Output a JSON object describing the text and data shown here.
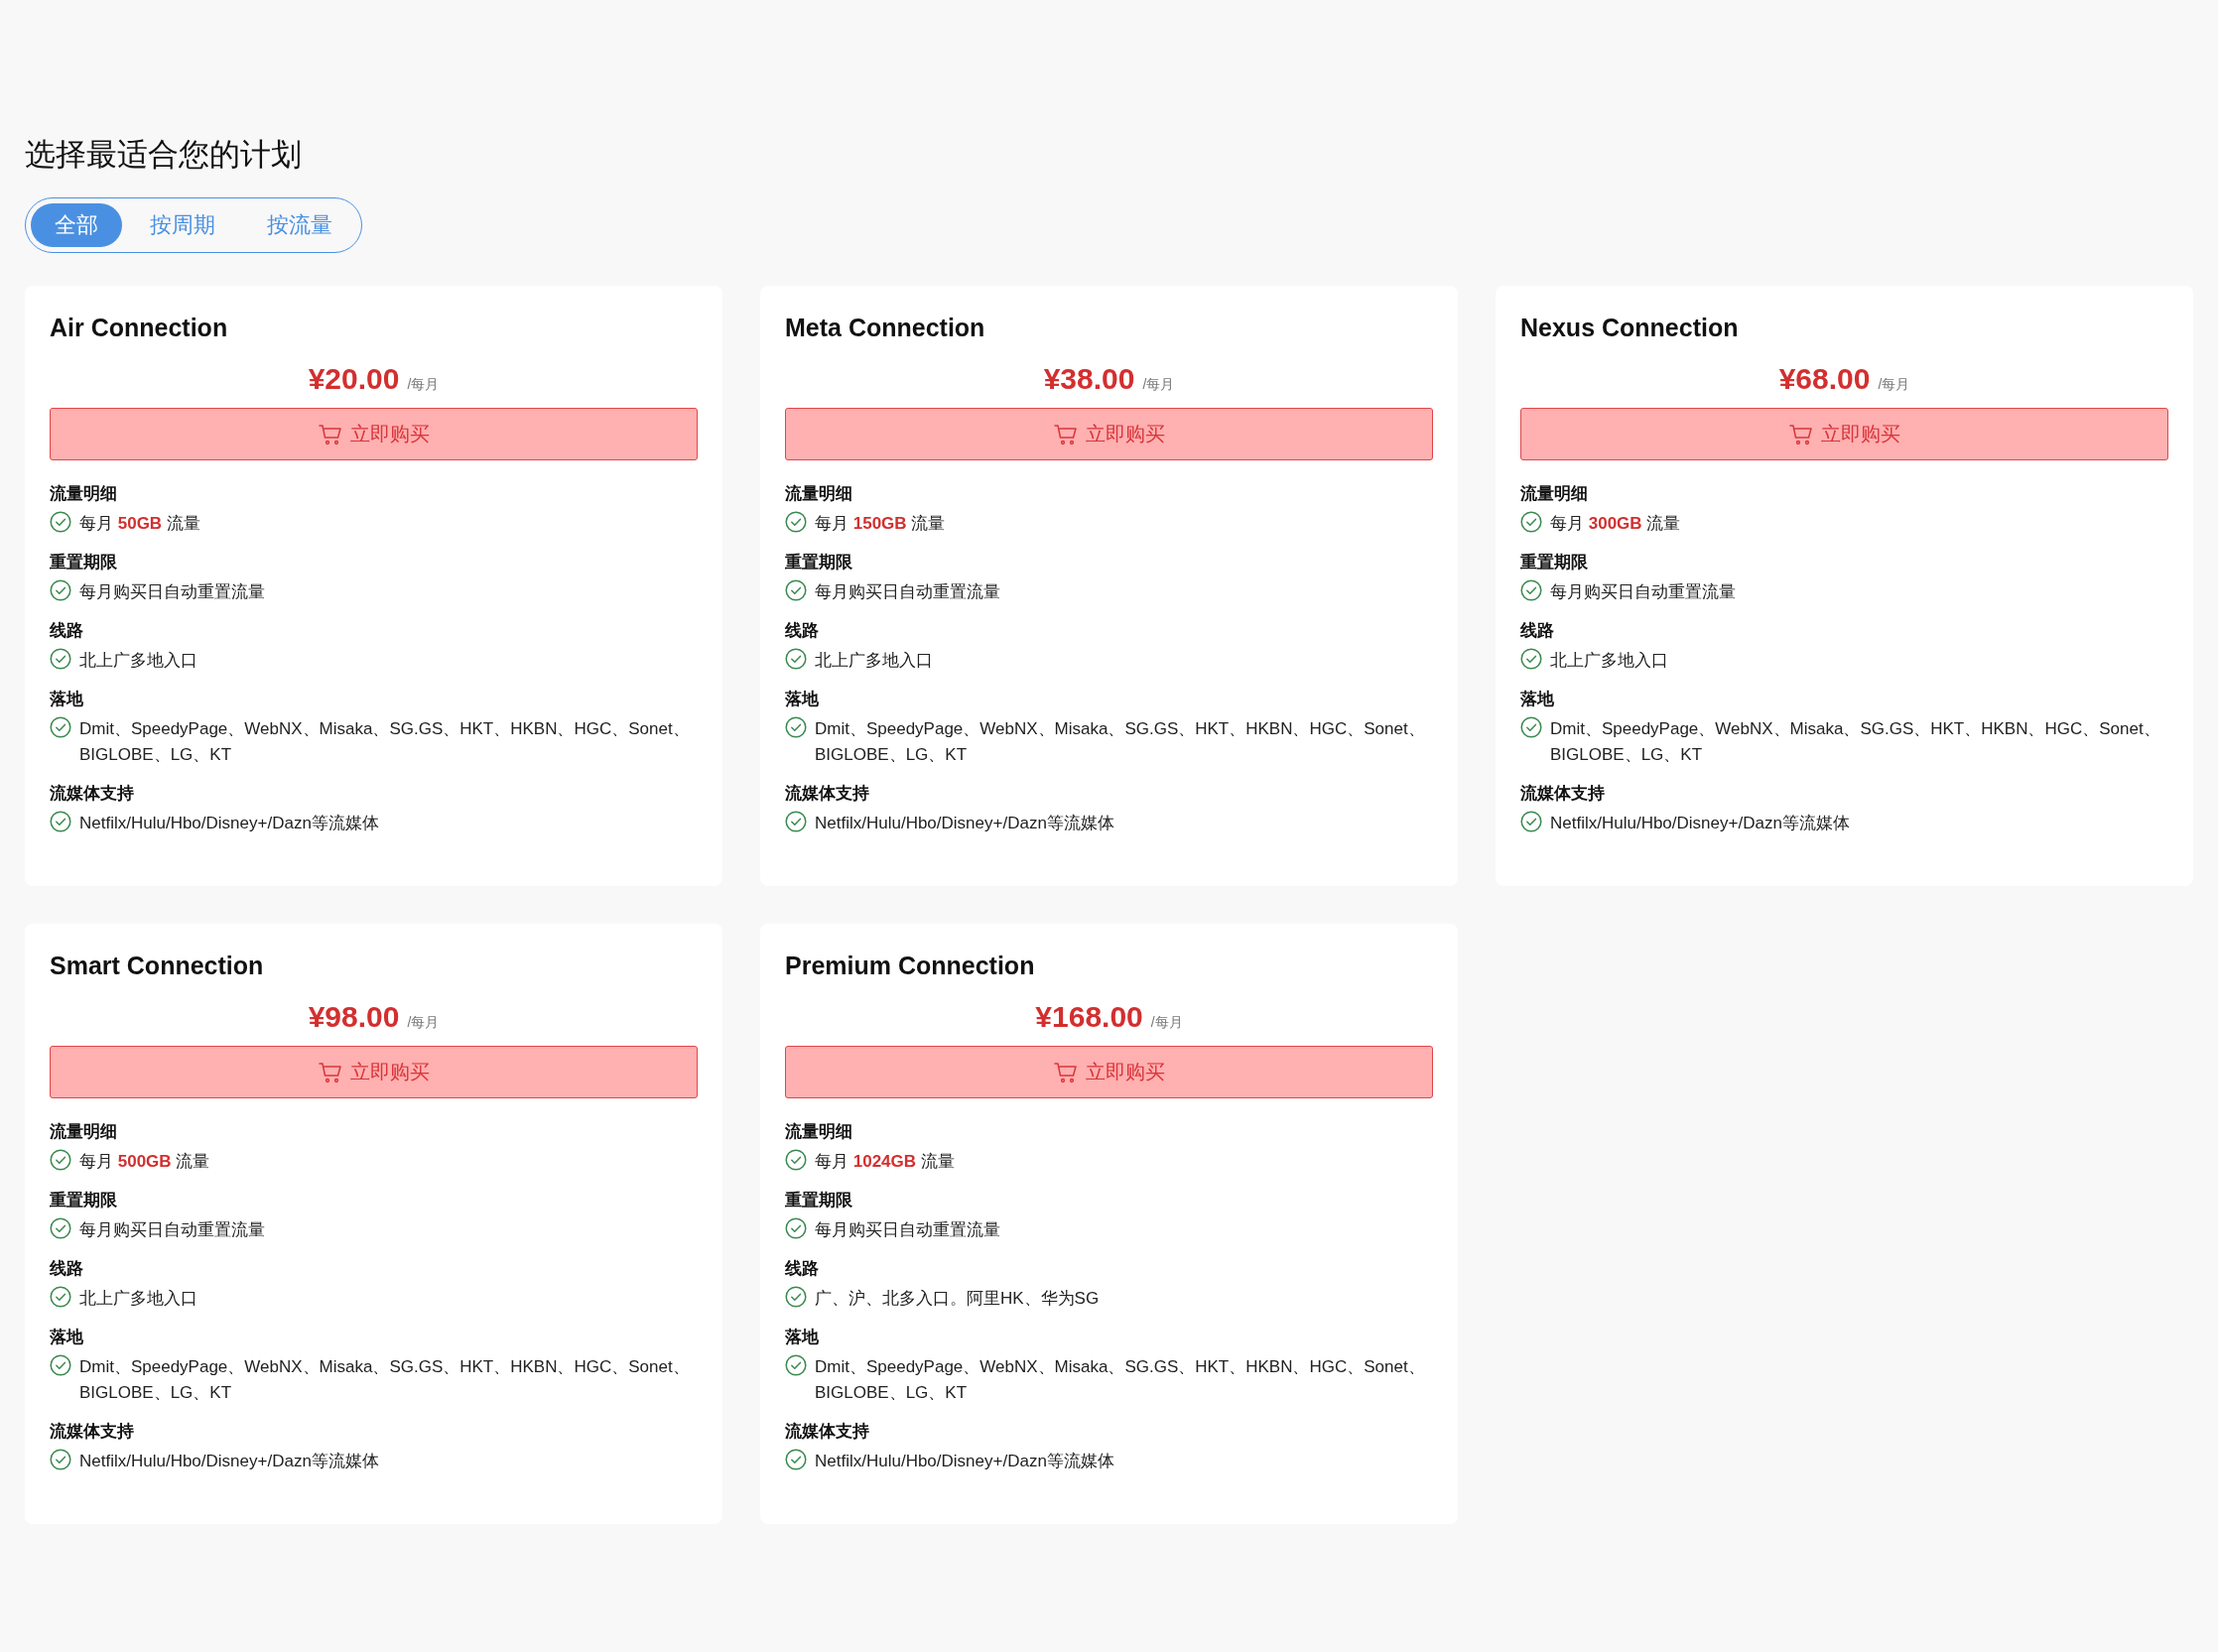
{
  "heading": "选择最适合您的计划",
  "tabs": [
    {
      "label": "全部",
      "selected": true
    },
    {
      "label": "按周期",
      "selected": false
    },
    {
      "label": "按流量",
      "selected": false
    }
  ],
  "plans": [
    {
      "name": "Air Connection",
      "price": "¥20.00",
      "period": "/每月",
      "button": "立即购买",
      "sections": [
        {
          "heading": "流量明细",
          "items": [
            "每月 **50GB** 流量"
          ]
        },
        {
          "heading": "重置期限",
          "items": [
            "每月购买日自动重置流量"
          ]
        },
        {
          "heading": "线路",
          "items": [
            "北上广多地入口"
          ]
        },
        {
          "heading": "落地",
          "items": [
            "Dmit、SpeedyPage、WebNX、Misaka、SG.GS、HKT、HKBN、HGC、Sonet、BIGLOBE、LG、KT"
          ]
        },
        {
          "heading": "流媒体支持",
          "items": [
            "Netfilx/Hulu/Hbo/Disney+/Dazn等流媒体"
          ]
        }
      ]
    },
    {
      "name": "Meta Connection",
      "price": "¥38.00",
      "period": "/每月",
      "button": "立即购买",
      "sections": [
        {
          "heading": "流量明细",
          "items": [
            "每月 **150GB** 流量"
          ]
        },
        {
          "heading": "重置期限",
          "items": [
            "每月购买日自动重置流量"
          ]
        },
        {
          "heading": "线路",
          "items": [
            "北上广多地入口"
          ]
        },
        {
          "heading": "落地",
          "items": [
            "Dmit、SpeedyPage、WebNX、Misaka、SG.GS、HKT、HKBN、HGC、Sonet、BIGLOBE、LG、KT"
          ]
        },
        {
          "heading": "流媒体支持",
          "items": [
            "Netfilx/Hulu/Hbo/Disney+/Dazn等流媒体"
          ]
        }
      ]
    },
    {
      "name": "Nexus Connection",
      "price": "¥68.00",
      "period": "/每月",
      "button": "立即购买",
      "sections": [
        {
          "heading": "流量明细",
          "items": [
            "每月 **300GB** 流量"
          ]
        },
        {
          "heading": "重置期限",
          "items": [
            "每月购买日自动重置流量"
          ]
        },
        {
          "heading": "线路",
          "items": [
            "北上广多地入口"
          ]
        },
        {
          "heading": "落地",
          "items": [
            "Dmit、SpeedyPage、WebNX、Misaka、SG.GS、HKT、HKBN、HGC、Sonet、BIGLOBE、LG、KT"
          ]
        },
        {
          "heading": "流媒体支持",
          "items": [
            "Netfilx/Hulu/Hbo/Disney+/Dazn等流媒体"
          ]
        }
      ]
    },
    {
      "name": "Smart Connection",
      "price": "¥98.00",
      "period": "/每月",
      "button": "立即购买",
      "sections": [
        {
          "heading": "流量明细",
          "items": [
            "每月 **500GB** 流量"
          ]
        },
        {
          "heading": "重置期限",
          "items": [
            "每月购买日自动重置流量"
          ]
        },
        {
          "heading": "线路",
          "items": [
            "北上广多地入口"
          ]
        },
        {
          "heading": "落地",
          "items": [
            "Dmit、SpeedyPage、WebNX、Misaka、SG.GS、HKT、HKBN、HGC、Sonet、BIGLOBE、LG、KT"
          ]
        },
        {
          "heading": "流媒体支持",
          "items": [
            "Netfilx/Hulu/Hbo/Disney+/Dazn等流媒体"
          ]
        }
      ]
    },
    {
      "name": "Premium Connection",
      "price": "¥168.00",
      "period": "/每月",
      "button": "立即购买",
      "sections": [
        {
          "heading": "流量明细",
          "items": [
            "每月 **1024GB** 流量"
          ]
        },
        {
          "heading": "重置期限",
          "items": [
            "每月购买日自动重置流量"
          ]
        },
        {
          "heading": "线路",
          "items": [
            "广、沪、北多入口。阿里HK、华为SG"
          ]
        },
        {
          "heading": "落地",
          "items": [
            "Dmit、SpeedyPage、WebNX、Misaka、SG.GS、HKT、HKBN、HGC、Sonet、BIGLOBE、LG、KT"
          ]
        },
        {
          "heading": "流媒体支持",
          "items": [
            "Netfilx/Hulu/Hbo/Disney+/Dazn等流媒体"
          ]
        }
      ]
    }
  ]
}
